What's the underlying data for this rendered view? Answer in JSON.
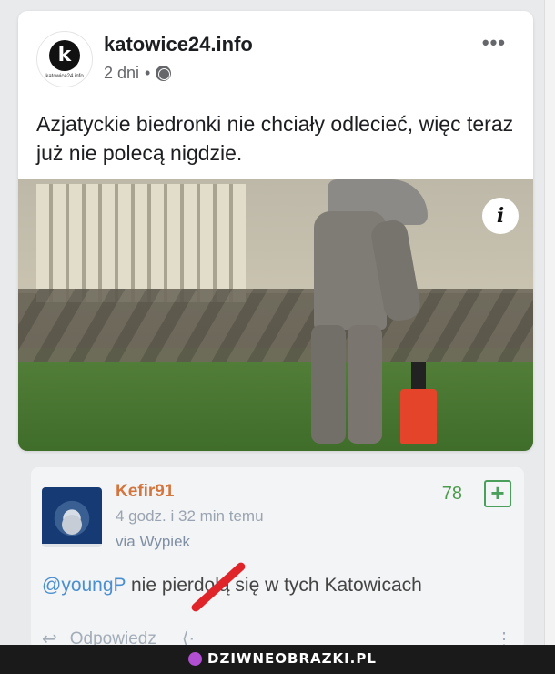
{
  "post": {
    "page_name": "katowice24.info",
    "logo_letter": "k",
    "logo_subtext": "katowice24.info",
    "time": "2 dni",
    "separator": "•",
    "more_label": "•••",
    "text": "Azjatyckie biedronki nie chciały odlecieć, więc teraz już nie polecą nigdzie.",
    "info_label": "i"
  },
  "comment": {
    "username": "Kefir91",
    "time": "4 godz. i 32 min temu",
    "via": "via Wypiek",
    "score": "78",
    "plus_label": "+",
    "mention": "@youngP",
    "text": " nie pierdolą się w tych Katowicach",
    "reply_label": "Odpowiedz",
    "dots_label": "⋮"
  },
  "watermark": {
    "brand": "DZIWNEOBRAZKI.PL"
  },
  "colors": {
    "username": "#d4753d",
    "score": "#4d9b4d",
    "mention": "#4a8fcf",
    "red_mark": "#e0252a"
  },
  "icons": [
    "globe-icon",
    "more-icon",
    "info-icon",
    "plus-icon",
    "reply-icon",
    "share-icon",
    "dots-icon",
    "brand-icon"
  ]
}
